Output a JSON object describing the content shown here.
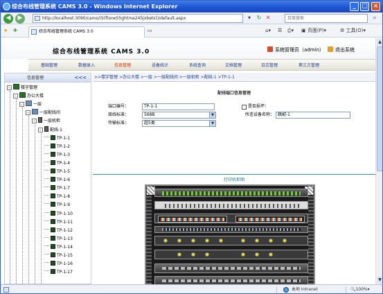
{
  "window": {
    "title": "综合布线管理系统 CAMS 3.0 - Windows Internet Explorer",
    "min": "_",
    "max": "□",
    "close": "×"
  },
  "browser": {
    "url": "http://localhost:3090/cams/(S(ftone55ghtma245jxbets))/default.aspx",
    "search_placeholder": "百度搜索",
    "tab_title": "综合布线管理系统 CAMS 3.0",
    "page_menu": "页面(P)",
    "tools_menu": "工具(O)",
    "status_left": "",
    "status_zone": "本地 Intranet",
    "status_zoom": "100%"
  },
  "header": {
    "app_title": "综合布线管理系统 CAMS 3.0",
    "user_link": "系统管理员（admin）",
    "exit_link": "退出系统"
  },
  "menu": {
    "items": [
      "基础管理",
      "数据录入",
      "信息管理",
      "设备统计",
      "系统查询",
      "文档管理",
      "日志管理",
      "第三方管理"
    ],
    "active_index": 2
  },
  "left_panel": {
    "title": "信息管理",
    "collapse": "<<<",
    "tree": [
      {
        "label": "楼宇管理",
        "level": 0,
        "kind": "bldg",
        "exp": "-"
      },
      {
        "label": "办公大楼",
        "level": 1,
        "kind": "bldg",
        "exp": "-"
      },
      {
        "label": "一层",
        "level": 2,
        "kind": "pc",
        "exp": "-"
      },
      {
        "label": "一层配线间",
        "level": 3,
        "kind": "pc",
        "exp": "-"
      },
      {
        "label": "一层机柜",
        "level": 4,
        "kind": "rack",
        "exp": "-"
      },
      {
        "label": "配线-1",
        "level": 5,
        "kind": "rack",
        "exp": "-"
      },
      {
        "label": "TP-1-1",
        "level": 6,
        "kind": "port"
      },
      {
        "label": "TP-1-2",
        "level": 6,
        "kind": "port"
      },
      {
        "label": "TP-1-3",
        "level": 6,
        "kind": "port"
      },
      {
        "label": "TP-1-4",
        "level": 6,
        "kind": "port"
      },
      {
        "label": "TP-1-5",
        "level": 6,
        "kind": "port"
      },
      {
        "label": "TP-1-6",
        "level": 6,
        "kind": "port"
      },
      {
        "label": "TP-1-7",
        "level": 6,
        "kind": "port"
      },
      {
        "label": "TP-1-8",
        "level": 6,
        "kind": "port"
      },
      {
        "label": "TP-1-9",
        "level": 6,
        "kind": "port"
      },
      {
        "label": "TP-1-10",
        "level": 6,
        "kind": "port"
      },
      {
        "label": "TP-1-11",
        "level": 6,
        "kind": "port"
      },
      {
        "label": "TP-1-12",
        "level": 6,
        "kind": "port"
      },
      {
        "label": "TP-1-13",
        "level": 6,
        "kind": "port"
      },
      {
        "label": "TP-1-14",
        "level": 6,
        "kind": "port"
      },
      {
        "label": "TP-1-15",
        "level": 6,
        "kind": "port"
      },
      {
        "label": "TP-1-16",
        "level": 6,
        "kind": "port"
      },
      {
        "label": "TP-1-17",
        "level": 6,
        "kind": "port"
      }
    ]
  },
  "breadcrumb": ">>楼宇管理 >办公大楼 >一层 >一层配线间 >一层机柜 >配线-1 >TP-1-1",
  "form": {
    "title": "配线端口信息管理",
    "port_no_label": "端口编号：",
    "port_no_value": "TP-1-1",
    "occupied_label": "是否损坏：",
    "type_label": "接线标准：",
    "type_value": "568B",
    "device_label": "所连设备名称：",
    "device_value": "跳配-1",
    "status_label": "传输标准：",
    "status_value": "超5类"
  },
  "figure": {
    "title": "打印机柜图"
  }
}
